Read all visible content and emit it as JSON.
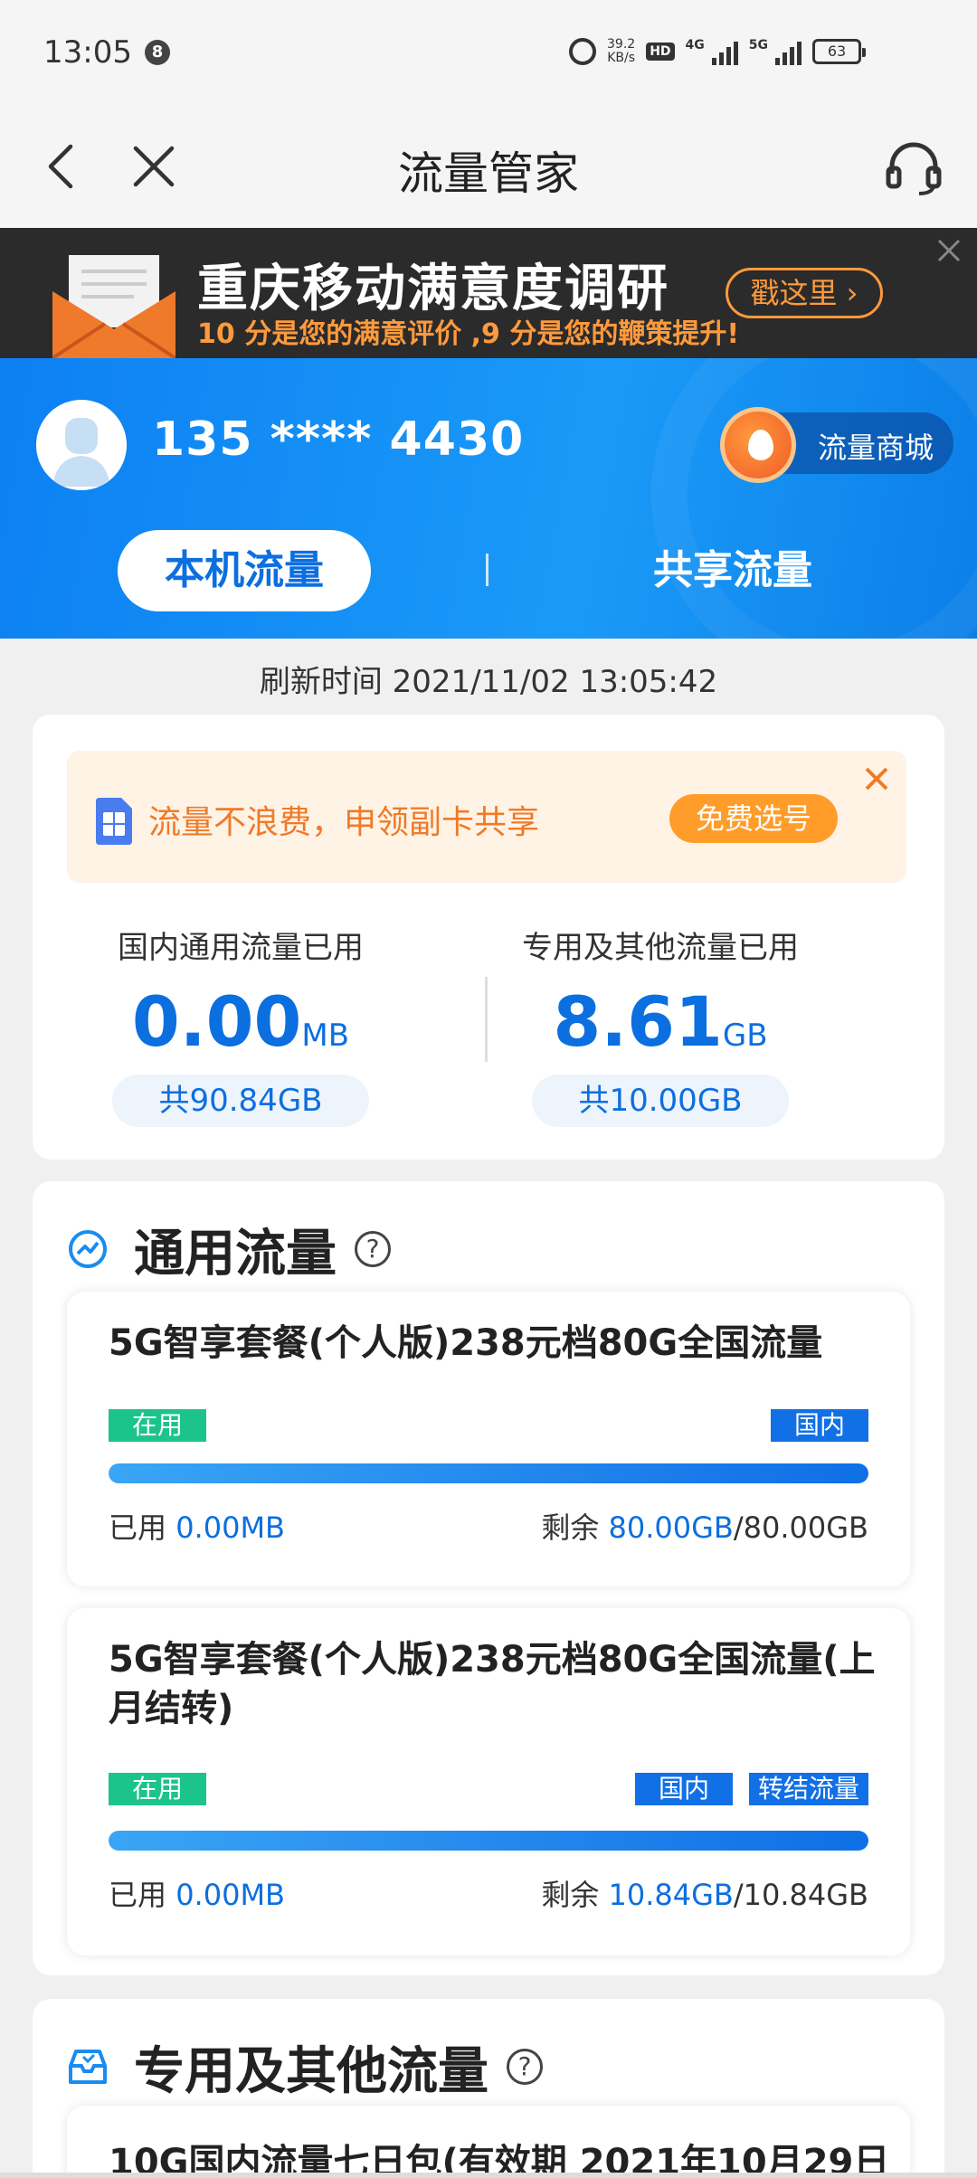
{
  "status_bar": {
    "time": "13:05",
    "notification_count": "8",
    "net_speed_value": "39.2",
    "net_speed_unit": "KB/s",
    "hd_label": "HD",
    "sim1_network": "4G",
    "sim2_network": "5G",
    "battery": "63"
  },
  "nav": {
    "title": "流量管家"
  },
  "banner": {
    "title": "重庆移动满意度调研",
    "subtitle": "10 分是您的满意评价 ,9 分是您的鞭策提升!",
    "button": "戳这里 ›"
  },
  "account": {
    "phone": "135 **** 4430",
    "mall_label": "流量商城",
    "tab_local": "本机流量",
    "tab_shared": "共享流量"
  },
  "refresh_time": "刷新时间 2021/11/02 13:05:42",
  "promo": {
    "text": "流量不浪费，申领副卡共享",
    "button": "免费选号"
  },
  "summary": {
    "general": {
      "label": "国内通用流量已用",
      "value": "0.00",
      "unit": "MB",
      "total": "共90.84GB"
    },
    "special": {
      "label": "专用及其他流量已用",
      "value": "8.61",
      "unit": "GB",
      "total": "共10.00GB"
    }
  },
  "general_section": {
    "title": "通用流量",
    "help": "?",
    "packages": [
      {
        "name": "5G智享套餐(个人版)238元档80G全国流量",
        "status_tag": "在用",
        "tags": [
          "国内"
        ],
        "used_label": "已用",
        "used_value": "0.00MB",
        "remaining_label": "剩余",
        "remaining_value": "80.00GB",
        "total": "/80.00GB",
        "remaining_fraction": 1.0
      },
      {
        "name": "5G智享套餐(个人版)238元档80G全国流量(上月结转)",
        "status_tag": "在用",
        "tags": [
          "国内",
          "转结流量"
        ],
        "used_label": "已用",
        "used_value": "0.00MB",
        "remaining_label": "剩余",
        "remaining_value": "10.84GB",
        "total": "/10.84GB",
        "remaining_fraction": 1.0
      }
    ]
  },
  "special_section": {
    "title": "专用及其他流量",
    "help": "?",
    "packages": [
      {
        "name": "10G国内流量七日包(有效期 2021年10月29日"
      }
    ]
  },
  "colors": {
    "primary_blue": "#0c6fe0",
    "hero_blue": "#1a9af8",
    "orange": "#ff9c2a",
    "green_tag": "#1cc48c"
  }
}
